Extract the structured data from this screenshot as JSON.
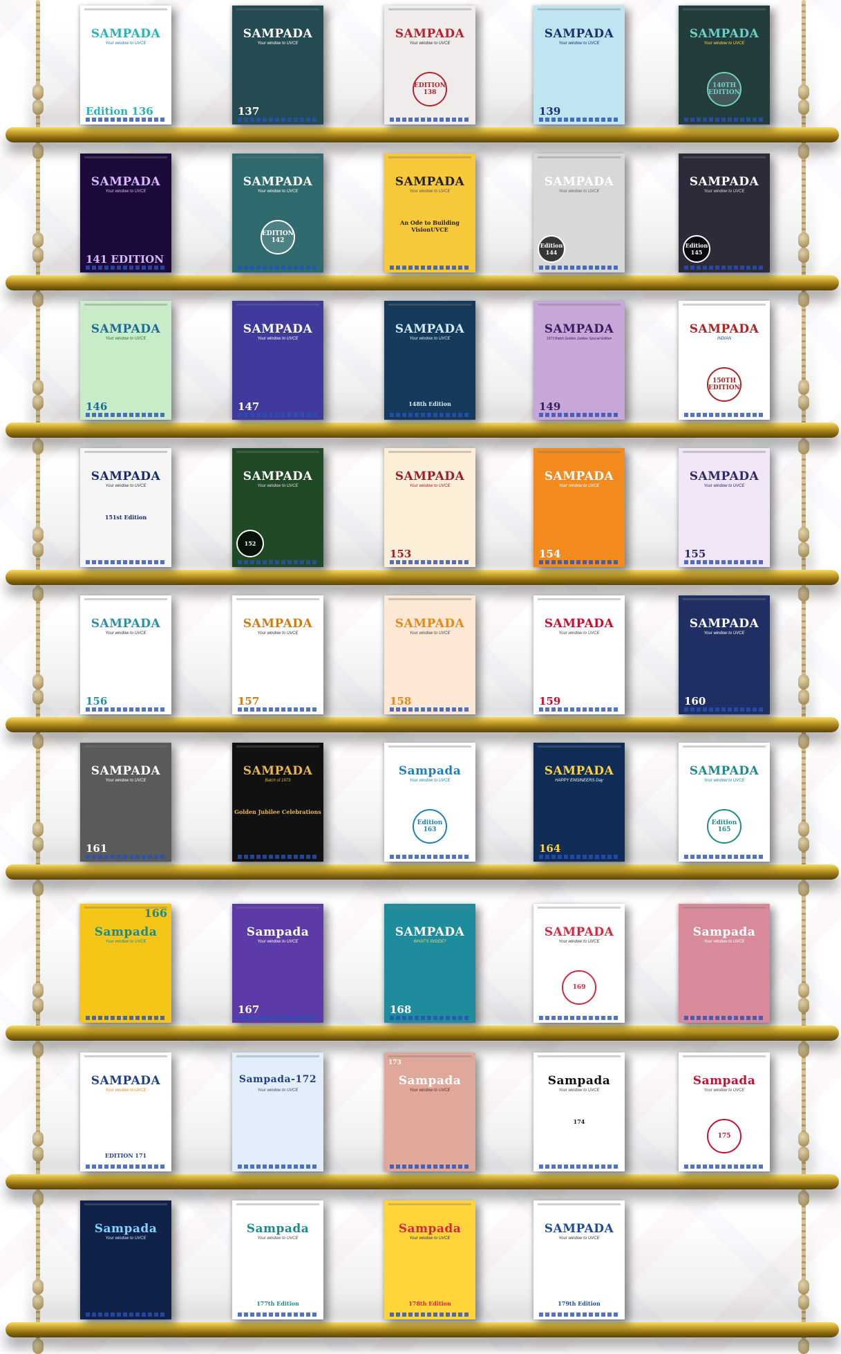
{
  "colors": {
    "shelf_gold": "#c7a22b",
    "rope": "#d8c79a"
  },
  "shelves": [
    {
      "books": [
        {
          "title": "SAMPADA",
          "tagline": "Your window to UVCE",
          "edition": "Edition 136",
          "bg": "#ffffff",
          "fg": "#29b3b5",
          "tagcolor": "#2a7ab8",
          "style": "illustration"
        },
        {
          "title": "SAMPADA",
          "tagline": "Your window to UVCE",
          "edition": "137",
          "bg": "#244b52",
          "fg": "#ffffff",
          "tagcolor": "#ffffff",
          "style": "corner"
        },
        {
          "title": "SAMPADA",
          "tagline": "Your window to UVCE",
          "edition": "EDITION 138",
          "bg": "#f1ecec",
          "fg": "#b5232e",
          "tagcolor": "#333333",
          "style": "badge"
        },
        {
          "title": "SAMPADA",
          "tagline": "Your window to UVCE",
          "edition": "139",
          "bg": "#bfe6f0",
          "fg": "#1d2f70",
          "tagcolor": "#1d2f70",
          "style": "corner"
        },
        {
          "title": "SAMPADA",
          "tagline": "Your window to UVCE",
          "edition": "140TH EDITION",
          "bg": "#233d3d",
          "fg": "#6fd0c8",
          "tagcolor": "#ffd54a",
          "style": "badge"
        }
      ]
    },
    {
      "books": [
        {
          "title": "SAMPADA",
          "tagline": "Your window to UVCE",
          "edition": "141 EDITION",
          "bg": "#1b0a3a",
          "fg": "#d9b4ff",
          "tagcolor": "#d9b4ff",
          "style": "corner"
        },
        {
          "title": "SAMPADA",
          "tagline": "Your window to UVCE",
          "edition": "EDITION 142",
          "bg": "#2f6b6e",
          "fg": "#ffffff",
          "tagcolor": "#ffffff",
          "style": "badge"
        },
        {
          "title": "SAMPADA",
          "tagline": "Your window to UVCE",
          "edition": "An Ode to Building VisionUVCE",
          "bg": "#f7c93a",
          "fg": "#222222",
          "tagcolor": "#555555",
          "style": "subtitle"
        },
        {
          "title": "SAMPADA",
          "tagline": "Your window to UVCE",
          "edition": "Edition 144",
          "bg": "#d8d8d8",
          "fg": "#ffffff",
          "tagcolor": "#666666",
          "style": "badge-low"
        },
        {
          "title": "SAMPADA",
          "tagline": "Your window to UVCE",
          "edition": "Edition 145",
          "bg": "#2d2a3a",
          "fg": "#ffffff",
          "tagcolor": "#dddddd",
          "style": "badge-low"
        }
      ]
    },
    {
      "books": [
        {
          "title": "SAMPADA",
          "tagline": "Your window to UVCE",
          "edition": "146",
          "bg": "#c9ecc8",
          "fg": "#1d6a9b",
          "tagcolor": "#2a6a40",
          "style": "corner"
        },
        {
          "title": "SAMPADA",
          "tagline": "Your window to UVCE",
          "edition": "147",
          "bg": "#3f3a9c",
          "fg": "#ffffff",
          "tagcolor": "#ffffff",
          "style": "corner"
        },
        {
          "title": "SAMPADA",
          "tagline": "Your window to UVCE",
          "edition": "148th Edition",
          "bg": "#163a5c",
          "fg": "#d5ecff",
          "tagcolor": "#d5ecff",
          "style": "subtitle-low"
        },
        {
          "title": "SAMPADA",
          "tagline": "1973 Batch Golden Jubilee Special Edition",
          "edition": "149",
          "bg": "#c7a6d8",
          "fg": "#3b1b60",
          "tagcolor": "#3b1b60",
          "style": "corner"
        },
        {
          "title": "SAMPADA",
          "tagline": "INDIAN",
          "edition": "150TH EDITION",
          "bg": "#ffffff",
          "fg": "#b22222",
          "tagcolor": "#1f3f8a",
          "style": "badge"
        }
      ]
    },
    {
      "books": [
        {
          "title": "SAMPADA",
          "tagline": "Your window to UVCE",
          "edition": "151st Edition",
          "bg": "#f5f5f5",
          "fg": "#1a2a6e",
          "tagcolor": "#333333",
          "style": "subtitle"
        },
        {
          "title": "SAMPADA",
          "tagline": "Your window to UVCE",
          "edition": "152",
          "bg": "#1f4a25",
          "fg": "#ffffff",
          "tagcolor": "#e0e0e0",
          "style": "badge-low"
        },
        {
          "title": "SAMPADA",
          "tagline": "Your window to UVCE",
          "edition": "153",
          "bg": "#fcefd8",
          "fg": "#9a1f2a",
          "tagcolor": "#9a1f2a",
          "style": "corner"
        },
        {
          "title": "SAMPADA",
          "tagline": "Your window to UVCE",
          "edition": "154",
          "bg": "#f28a1e",
          "fg": "#ffffff",
          "tagcolor": "#ffffff",
          "style": "corner"
        },
        {
          "title": "SAMPADA",
          "tagline": "Your window to UVCE",
          "edition": "155",
          "bg": "#f0e6f5",
          "fg": "#2a2a6a",
          "tagcolor": "#2a2a6a",
          "style": "corner"
        }
      ]
    },
    {
      "books": [
        {
          "title": "SAMPADA",
          "tagline": "Your window to UVCE",
          "edition": "156",
          "bg": "#ffffff",
          "fg": "#2c8fa5",
          "tagcolor": "#333333",
          "style": "corner"
        },
        {
          "title": "SAMPADA",
          "tagline": "Your window to UVCE",
          "edition": "157",
          "bg": "#ffffff",
          "fg": "#d07a12",
          "tagcolor": "#333333",
          "style": "corner"
        },
        {
          "title": "SAMPADA",
          "tagline": "Your window to UVCE",
          "edition": "158",
          "bg": "#fde7d5",
          "fg": "#e38a1c",
          "tagcolor": "#444444",
          "style": "corner"
        },
        {
          "title": "SAMPADA",
          "tagline": "Your window to UVCE",
          "edition": "159",
          "bg": "#ffffff",
          "fg": "#c8102e",
          "tagcolor": "#444444",
          "style": "corner"
        },
        {
          "title": "SAMPADA",
          "tagline": "Your window to UVCE",
          "edition": "160",
          "bg": "#1f2f63",
          "fg": "#ffffff",
          "tagcolor": "#ffffff",
          "style": "corner"
        }
      ]
    },
    {
      "books": [
        {
          "title": "SAMPADA",
          "tagline": "Your window to UVCE",
          "edition": "161",
          "bg": "#5a5a5a",
          "fg": "#ffffff",
          "tagcolor": "#ffffff",
          "style": "corner"
        },
        {
          "title": "SAMPADA",
          "tagline": "Batch of 1973",
          "edition": "Golden Jubilee Celebrations",
          "bg": "#111111",
          "fg": "#e6b84a",
          "tagcolor": "#e6b84a",
          "style": "subtitle"
        },
        {
          "title": "Sampada",
          "tagline": "Your window to UVCE",
          "edition": "Edition 163",
          "bg": "#ffffff",
          "fg": "#1c7fbf",
          "tagcolor": "#1c7fbf",
          "style": "badge"
        },
        {
          "title": "SAMPADA",
          "tagline": "HAPPY ENGINEERS Day",
          "edition": "164",
          "bg": "#0f2d56",
          "fg": "#ffd23f",
          "tagcolor": "#ffffff",
          "style": "corner"
        },
        {
          "title": "SAMPADA",
          "tagline": "Your window to UVCE",
          "edition": "Edition 165",
          "bg": "#ffffff",
          "fg": "#1f8a8a",
          "tagcolor": "#1f8a8a",
          "style": "badge"
        }
      ]
    },
    {
      "books": [
        {
          "title": "Sampada",
          "tagline": "Your window to UVCE",
          "edition": "166",
          "bg": "#f5c518",
          "fg": "#1f8a8a",
          "tagcolor": "#1f8a8a",
          "style": "top-right"
        },
        {
          "title": "Sampada",
          "tagline": "Your window to UVCE",
          "edition": "167",
          "bg": "#5c3aa8",
          "fg": "#ffffff",
          "tagcolor": "#ffffff",
          "style": "corner"
        },
        {
          "title": "SAMPADA",
          "tagline": "WHAT'S INSIDE?",
          "edition": "168",
          "bg": "#1f8c9e",
          "fg": "#ffffff",
          "tagcolor": "#ffd54a",
          "style": "corner"
        },
        {
          "title": "SAMPADA",
          "tagline": "Your window to UVCE",
          "edition": "169",
          "bg": "#ffffff",
          "fg": "#d7263d",
          "tagcolor": "#333333",
          "style": "badge"
        },
        {
          "title": "Sampada",
          "tagline": "Your window to UVCE",
          "edition": "",
          "bg": "#d98a9a",
          "fg": "#ffffff",
          "tagcolor": "#ffffff",
          "style": "none"
        }
      ]
    },
    {
      "books": [
        {
          "title": "SAMPADA",
          "tagline": "Your window to UVCE",
          "edition": "EDITION 171",
          "bg": "#ffffff",
          "fg": "#1f3f8a",
          "tagcolor": "#e08a1e",
          "style": "subtitle-low"
        },
        {
          "title": "Sampada-172",
          "tagline": "Your window to UVCE",
          "edition": "",
          "bg": "#e3eefc",
          "fg": "#1f3f8a",
          "tagcolor": "#444444",
          "style": "none"
        },
        {
          "title": "Sampada",
          "tagline": "Your window to UVCE",
          "edition": "173",
          "bg": "#e0a89a",
          "fg": "#ffffff",
          "tagcolor": "#5a2a20",
          "style": "top-left"
        },
        {
          "title": "Sampada",
          "tagline": "Your window to UVCE",
          "edition": "174",
          "bg": "#ffffff",
          "fg": "#111111",
          "tagcolor": "#444444",
          "style": "subtitle"
        },
        {
          "title": "Sampada",
          "tagline": "Your window to UVCE",
          "edition": "175",
          "bg": "#ffffff",
          "fg": "#c8102e",
          "tagcolor": "#444444",
          "style": "badge"
        }
      ]
    },
    {
      "books": [
        {
          "title": "Sampada",
          "tagline": "Your window to UVCE",
          "edition": "",
          "bg": "#10224a",
          "fg": "#7fd3ff",
          "tagcolor": "#cfe8ff",
          "style": "none"
        },
        {
          "title": "Sampada",
          "tagline": "Your window to UVCE",
          "edition": "177th Edition",
          "bg": "#ffffff",
          "fg": "#1f8a8a",
          "tagcolor": "#444444",
          "style": "subtitle-low"
        },
        {
          "title": "Sampada",
          "tagline": "Your window to UVCE",
          "edition": "178th Edition",
          "bg": "#ffd43b",
          "fg": "#d7263d",
          "tagcolor": "#333333",
          "style": "subtitle-low"
        },
        {
          "title": "SAMPADA",
          "tagline": "Your window to UVCE",
          "edition": "179th Edition",
          "bg": "#ffffff",
          "fg": "#1f4a9a",
          "tagcolor": "#333333",
          "style": "subtitle-low"
        }
      ]
    }
  ]
}
